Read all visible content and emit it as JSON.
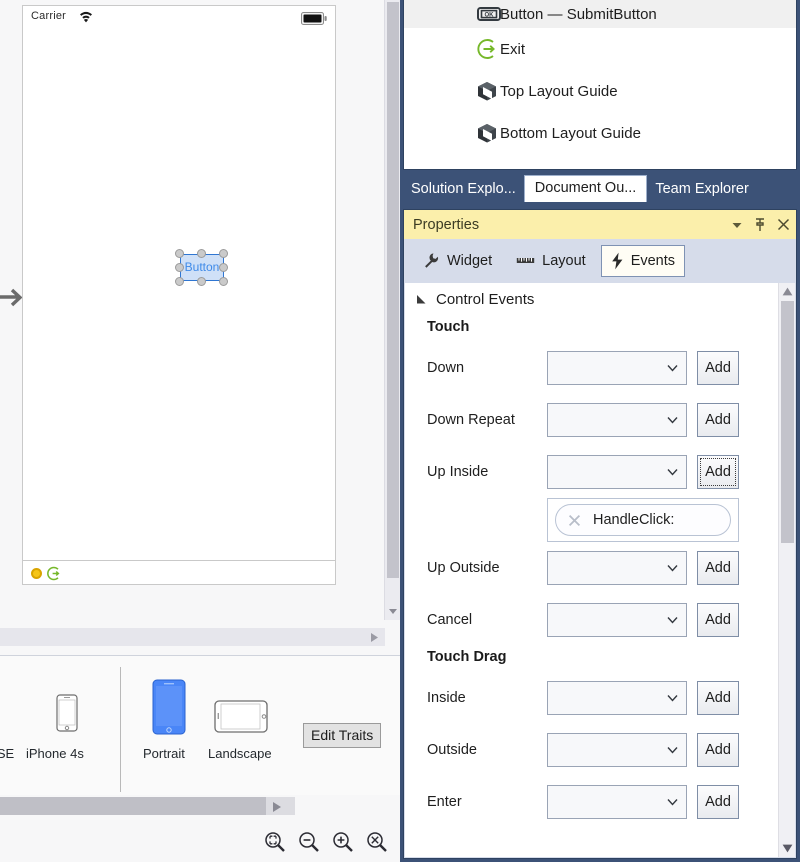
{
  "designer": {
    "simulator": {
      "carrier": "Carrier",
      "wifi_icon": "wifi-icon",
      "battery_icon": "battery-icon",
      "button_label": "Button",
      "vc_icon": "view-controller-icon",
      "exit_icon": "exit-icon"
    },
    "entry_arrow_icon": "entry-point-arrow-icon",
    "device_bar": {
      "devices": [
        {
          "label": "e SE",
          "icon": "iphone-se-icon"
        },
        {
          "label": "iPhone 4s",
          "icon": "iphone-4s-icon"
        }
      ],
      "orientations": [
        {
          "label": "Portrait",
          "icon": "iphone-portrait-icon",
          "selected": true
        },
        {
          "label": "Landscape",
          "icon": "iphone-landscape-icon",
          "selected": false
        }
      ],
      "edit_traits_label": "Edit Traits"
    },
    "zoom_controls": [
      {
        "name": "zoom-to-fit-icon"
      },
      {
        "name": "zoom-out-icon"
      },
      {
        "name": "zoom-in-icon"
      },
      {
        "name": "zoom-actual-size-icon"
      }
    ]
  },
  "outline": {
    "rows": [
      {
        "label": "Button  —  SubmitButton",
        "icon": "ok-button-icon",
        "selected": true
      },
      {
        "label": "Exit",
        "icon": "exit-icon",
        "selected": false
      },
      {
        "label": "Top Layout Guide",
        "icon": "layout-guide-icon",
        "selected": false
      },
      {
        "label": "Bottom Layout Guide",
        "icon": "layout-guide-icon",
        "selected": false
      }
    ]
  },
  "window_tabs": [
    {
      "label": "Solution Explo...",
      "active": false
    },
    {
      "label": "Document Ou...",
      "active": true
    },
    {
      "label": "Team Explorer",
      "active": false
    }
  ],
  "properties": {
    "title": "Properties",
    "title_buttons": [
      {
        "name": "window-menu-chevron-icon"
      },
      {
        "name": "pin-icon"
      },
      {
        "name": "close-icon"
      }
    ],
    "tabs": [
      {
        "label": "Widget",
        "icon": "wrench-icon",
        "active": false
      },
      {
        "label": "Layout",
        "icon": "ruler-icon",
        "active": false
      },
      {
        "label": "Events",
        "icon": "lightning-bolt-icon",
        "active": true
      }
    ],
    "section_header": "Control Events",
    "section_expand_icon": "triangle-expanded-icon",
    "groups": [
      {
        "name": "Touch",
        "rows": [
          {
            "label": "Down",
            "value": "",
            "add_label": "Add",
            "focused": false,
            "handlers": []
          },
          {
            "label": "Down Repeat",
            "value": "",
            "add_label": "Add",
            "focused": false,
            "handlers": []
          },
          {
            "label": "Up Inside",
            "value": "",
            "add_label": "Add",
            "focused": true,
            "handlers": [
              {
                "name": "HandleClick:",
                "remove_icon": "remove-x-icon"
              }
            ]
          },
          {
            "label": "Up Outside",
            "value": "",
            "add_label": "Add",
            "focused": false,
            "handlers": []
          },
          {
            "label": "Cancel",
            "value": "",
            "add_label": "Add",
            "focused": false,
            "handlers": []
          }
        ]
      },
      {
        "name": "Touch Drag",
        "rows": [
          {
            "label": "Inside",
            "value": "",
            "add_label": "Add",
            "focused": false,
            "handlers": []
          },
          {
            "label": "Outside",
            "value": "",
            "add_label": "Add",
            "focused": false,
            "handlers": []
          },
          {
            "label": "Enter",
            "value": "",
            "add_label": "Add",
            "focused": false,
            "handlers": []
          }
        ]
      }
    ],
    "dropdown_placeholder": ""
  },
  "colors": {
    "vs_chrome": "#3c5277",
    "title_bar": "#fbefab",
    "accent_blue": "#3f8ae8",
    "selection_border": "#2f76d2",
    "tab_active_bg": "#ffffff",
    "exit_green": "#76b82a",
    "vc_yellow": "#f5c518"
  }
}
